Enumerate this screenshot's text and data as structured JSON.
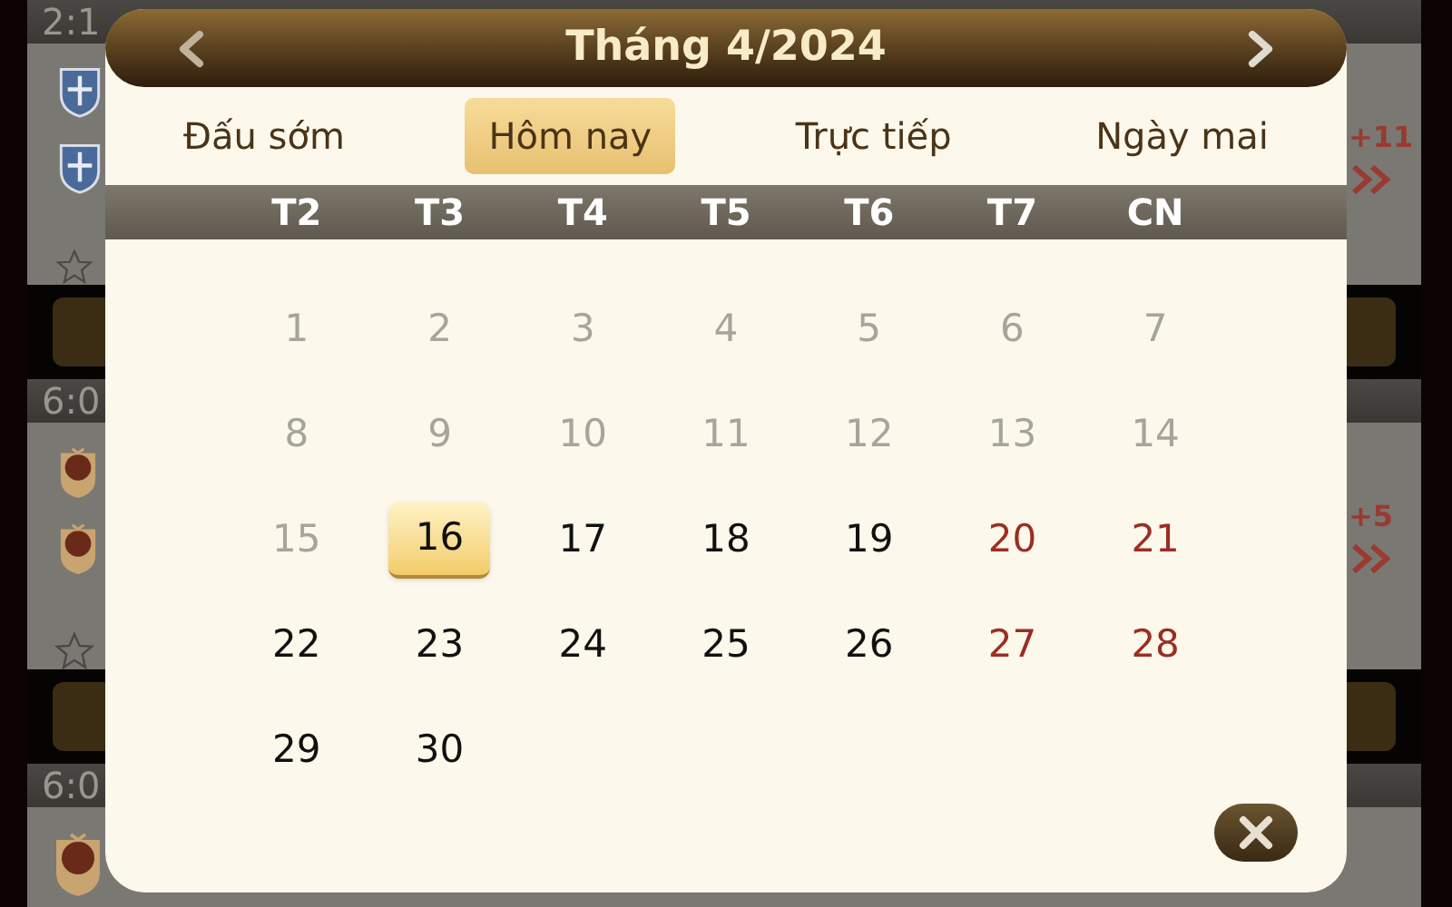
{
  "background": {
    "matches": [
      {
        "time": "2:1",
        "logos": [
          {
            "kind": "crest"
          },
          {
            "kind": "crest"
          }
        ],
        "badge": "+11"
      },
      {
        "time": "6:0",
        "logos": [
          {
            "kind": "shield"
          },
          {
            "kind": "shield"
          }
        ],
        "badge": "+5"
      },
      {
        "time": "6:0",
        "logos": [
          {
            "kind": "shield"
          }
        ]
      }
    ]
  },
  "calendar": {
    "title": "Tháng 4/2024",
    "tabs": [
      {
        "label": "Đấu sớm",
        "selected": false
      },
      {
        "label": "Hôm nay",
        "selected": true
      },
      {
        "label": "Trực tiếp",
        "selected": false
      },
      {
        "label": "Ngày mai",
        "selected": false
      }
    ],
    "weekdays": [
      "T2",
      "T3",
      "T4",
      "T5",
      "T6",
      "T7",
      "CN"
    ],
    "days": [
      {
        "label": "1",
        "kind": "past",
        "selected": false
      },
      {
        "label": "2",
        "kind": "past",
        "selected": false
      },
      {
        "label": "3",
        "kind": "past",
        "selected": false
      },
      {
        "label": "4",
        "kind": "past",
        "selected": false
      },
      {
        "label": "5",
        "kind": "past",
        "selected": false
      },
      {
        "label": "6",
        "kind": "past",
        "selected": false
      },
      {
        "label": "7",
        "kind": "past",
        "selected": false
      },
      {
        "label": "8",
        "kind": "past",
        "selected": false
      },
      {
        "label": "9",
        "kind": "past",
        "selected": false
      },
      {
        "label": "10",
        "kind": "past",
        "selected": false
      },
      {
        "label": "11",
        "kind": "past",
        "selected": false
      },
      {
        "label": "12",
        "kind": "past",
        "selected": false
      },
      {
        "label": "13",
        "kind": "past",
        "selected": false
      },
      {
        "label": "14",
        "kind": "past",
        "selected": false
      },
      {
        "label": "15",
        "kind": "past",
        "selected": false
      },
      {
        "label": "16",
        "kind": "normal",
        "selected": true
      },
      {
        "label": "17",
        "kind": "normal",
        "selected": false
      },
      {
        "label": "18",
        "kind": "normal",
        "selected": false
      },
      {
        "label": "19",
        "kind": "normal",
        "selected": false
      },
      {
        "label": "20",
        "kind": "weekend",
        "selected": false
      },
      {
        "label": "21",
        "kind": "weekend",
        "selected": false
      },
      {
        "label": "22",
        "kind": "normal",
        "selected": false
      },
      {
        "label": "23",
        "kind": "normal",
        "selected": false
      },
      {
        "label": "24",
        "kind": "normal",
        "selected": false
      },
      {
        "label": "25",
        "kind": "normal",
        "selected": false
      },
      {
        "label": "26",
        "kind": "normal",
        "selected": false
      },
      {
        "label": "27",
        "kind": "weekend",
        "selected": false
      },
      {
        "label": "28",
        "kind": "weekend",
        "selected": false
      },
      {
        "label": "29",
        "kind": "normal",
        "selected": false
      },
      {
        "label": "30",
        "kind": "normal",
        "selected": false
      }
    ]
  }
}
